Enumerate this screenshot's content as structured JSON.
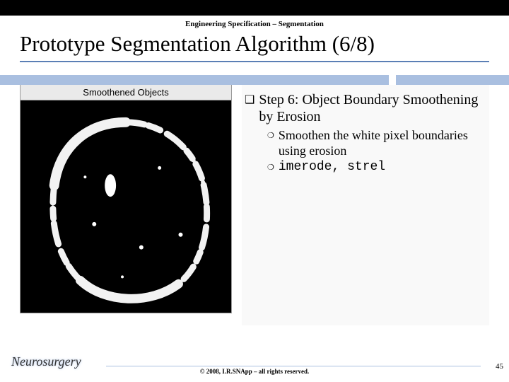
{
  "breadcrumb": "Engineering Specification – Segmentation",
  "title": "Prototype Segmentation Algorithm (6/8)",
  "figure": {
    "caption": "Smoothened Objects"
  },
  "bullets": {
    "step_title": "Step 6: Object Boundary Smoothening by Erosion",
    "sub1": "Smoothen the white pixel boundaries using erosion",
    "sub2": "imerode, strel"
  },
  "logo": "Neurosurgery",
  "copyright": "© 2008, I.R.SNApp – all rights reserved.",
  "page": "45"
}
